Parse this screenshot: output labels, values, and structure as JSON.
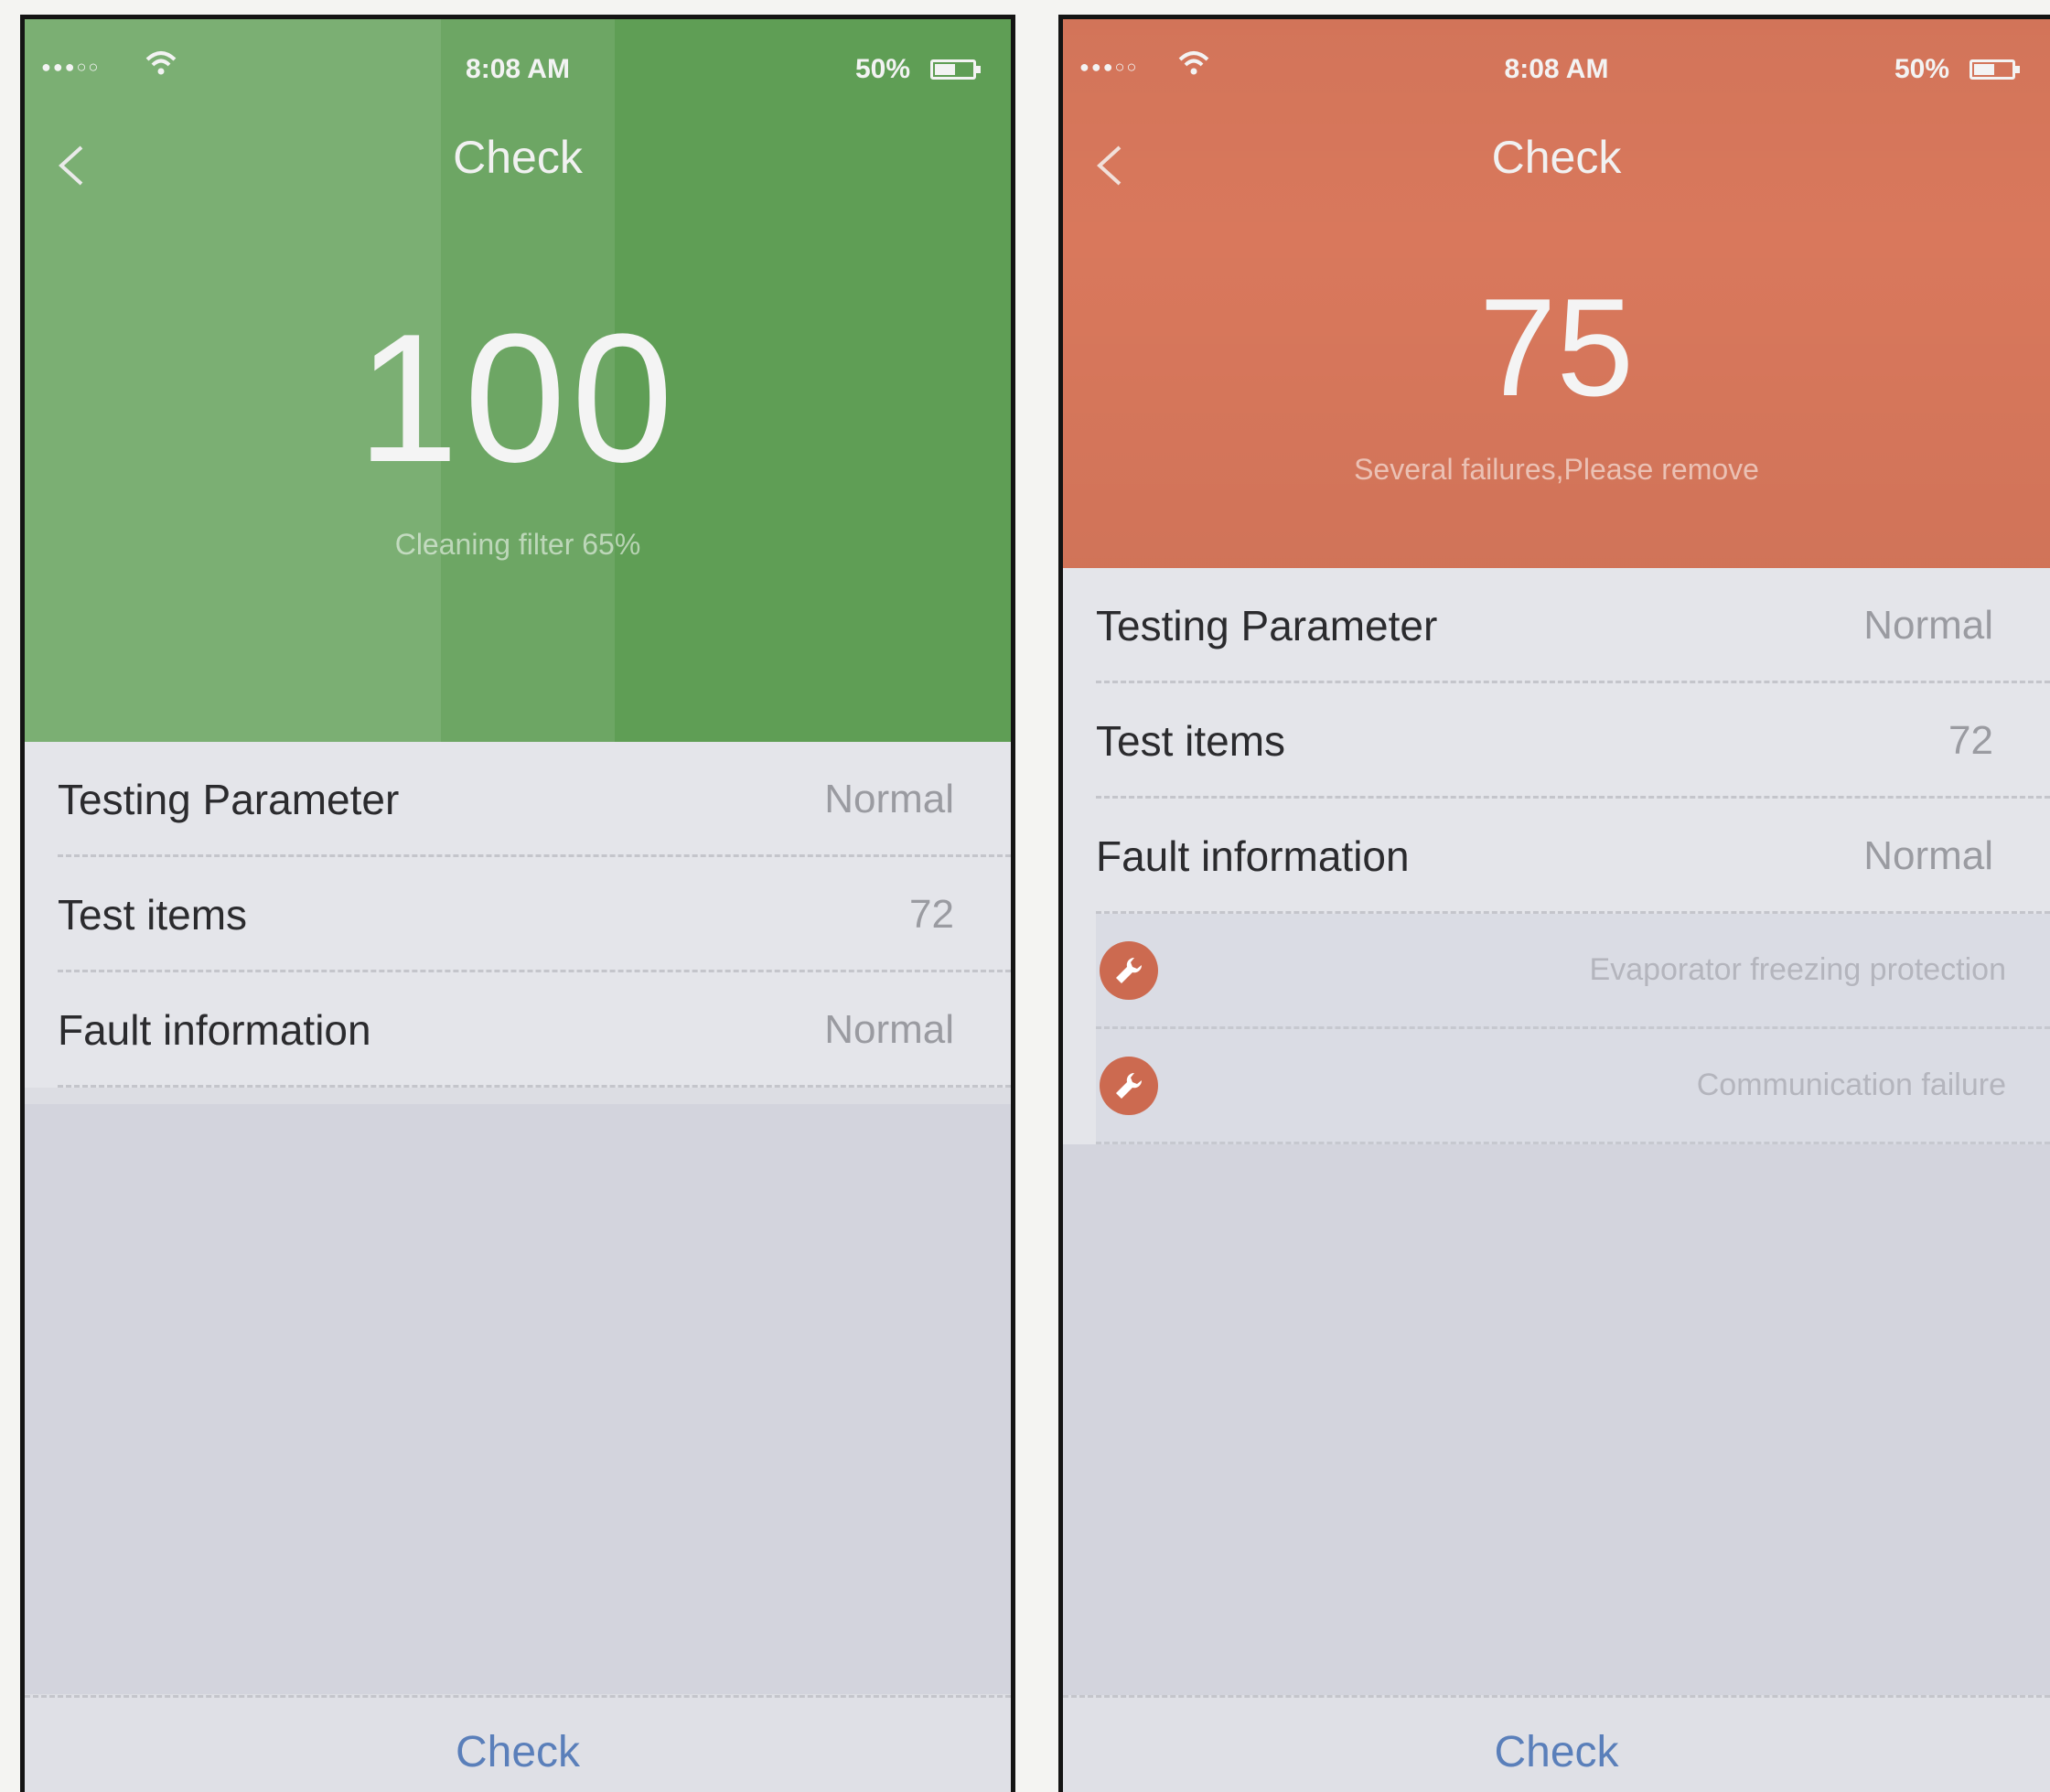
{
  "screens": [
    {
      "status": {
        "time": "8:08 AM",
        "battery": "50%"
      },
      "title": "Check",
      "score": "100",
      "subtitle": "Cleaning filter 65%",
      "rows": [
        {
          "label": "Testing Parameter",
          "value": "Normal"
        },
        {
          "label": "Test items",
          "value": "72"
        },
        {
          "label": "Fault information",
          "value": "Normal"
        }
      ],
      "faults": [],
      "button": "Check",
      "header_color": "#5f9e55"
    },
    {
      "status": {
        "time": "8:08 AM",
        "battery": "50%"
      },
      "title": "Check",
      "score": "75",
      "subtitle": "Several failures,Please remove",
      "rows": [
        {
          "label": "Testing Parameter",
          "value": "Normal"
        },
        {
          "label": "Test items",
          "value": "72"
        },
        {
          "label": "Fault information",
          "value": "Normal"
        }
      ],
      "faults": [
        {
          "icon": "wrench-icon",
          "text": "Evaporator freezing protection"
        },
        {
          "icon": "wrench-icon",
          "text": "Communication failure"
        }
      ],
      "button": "Check",
      "header_color": "#d9785c"
    }
  ]
}
